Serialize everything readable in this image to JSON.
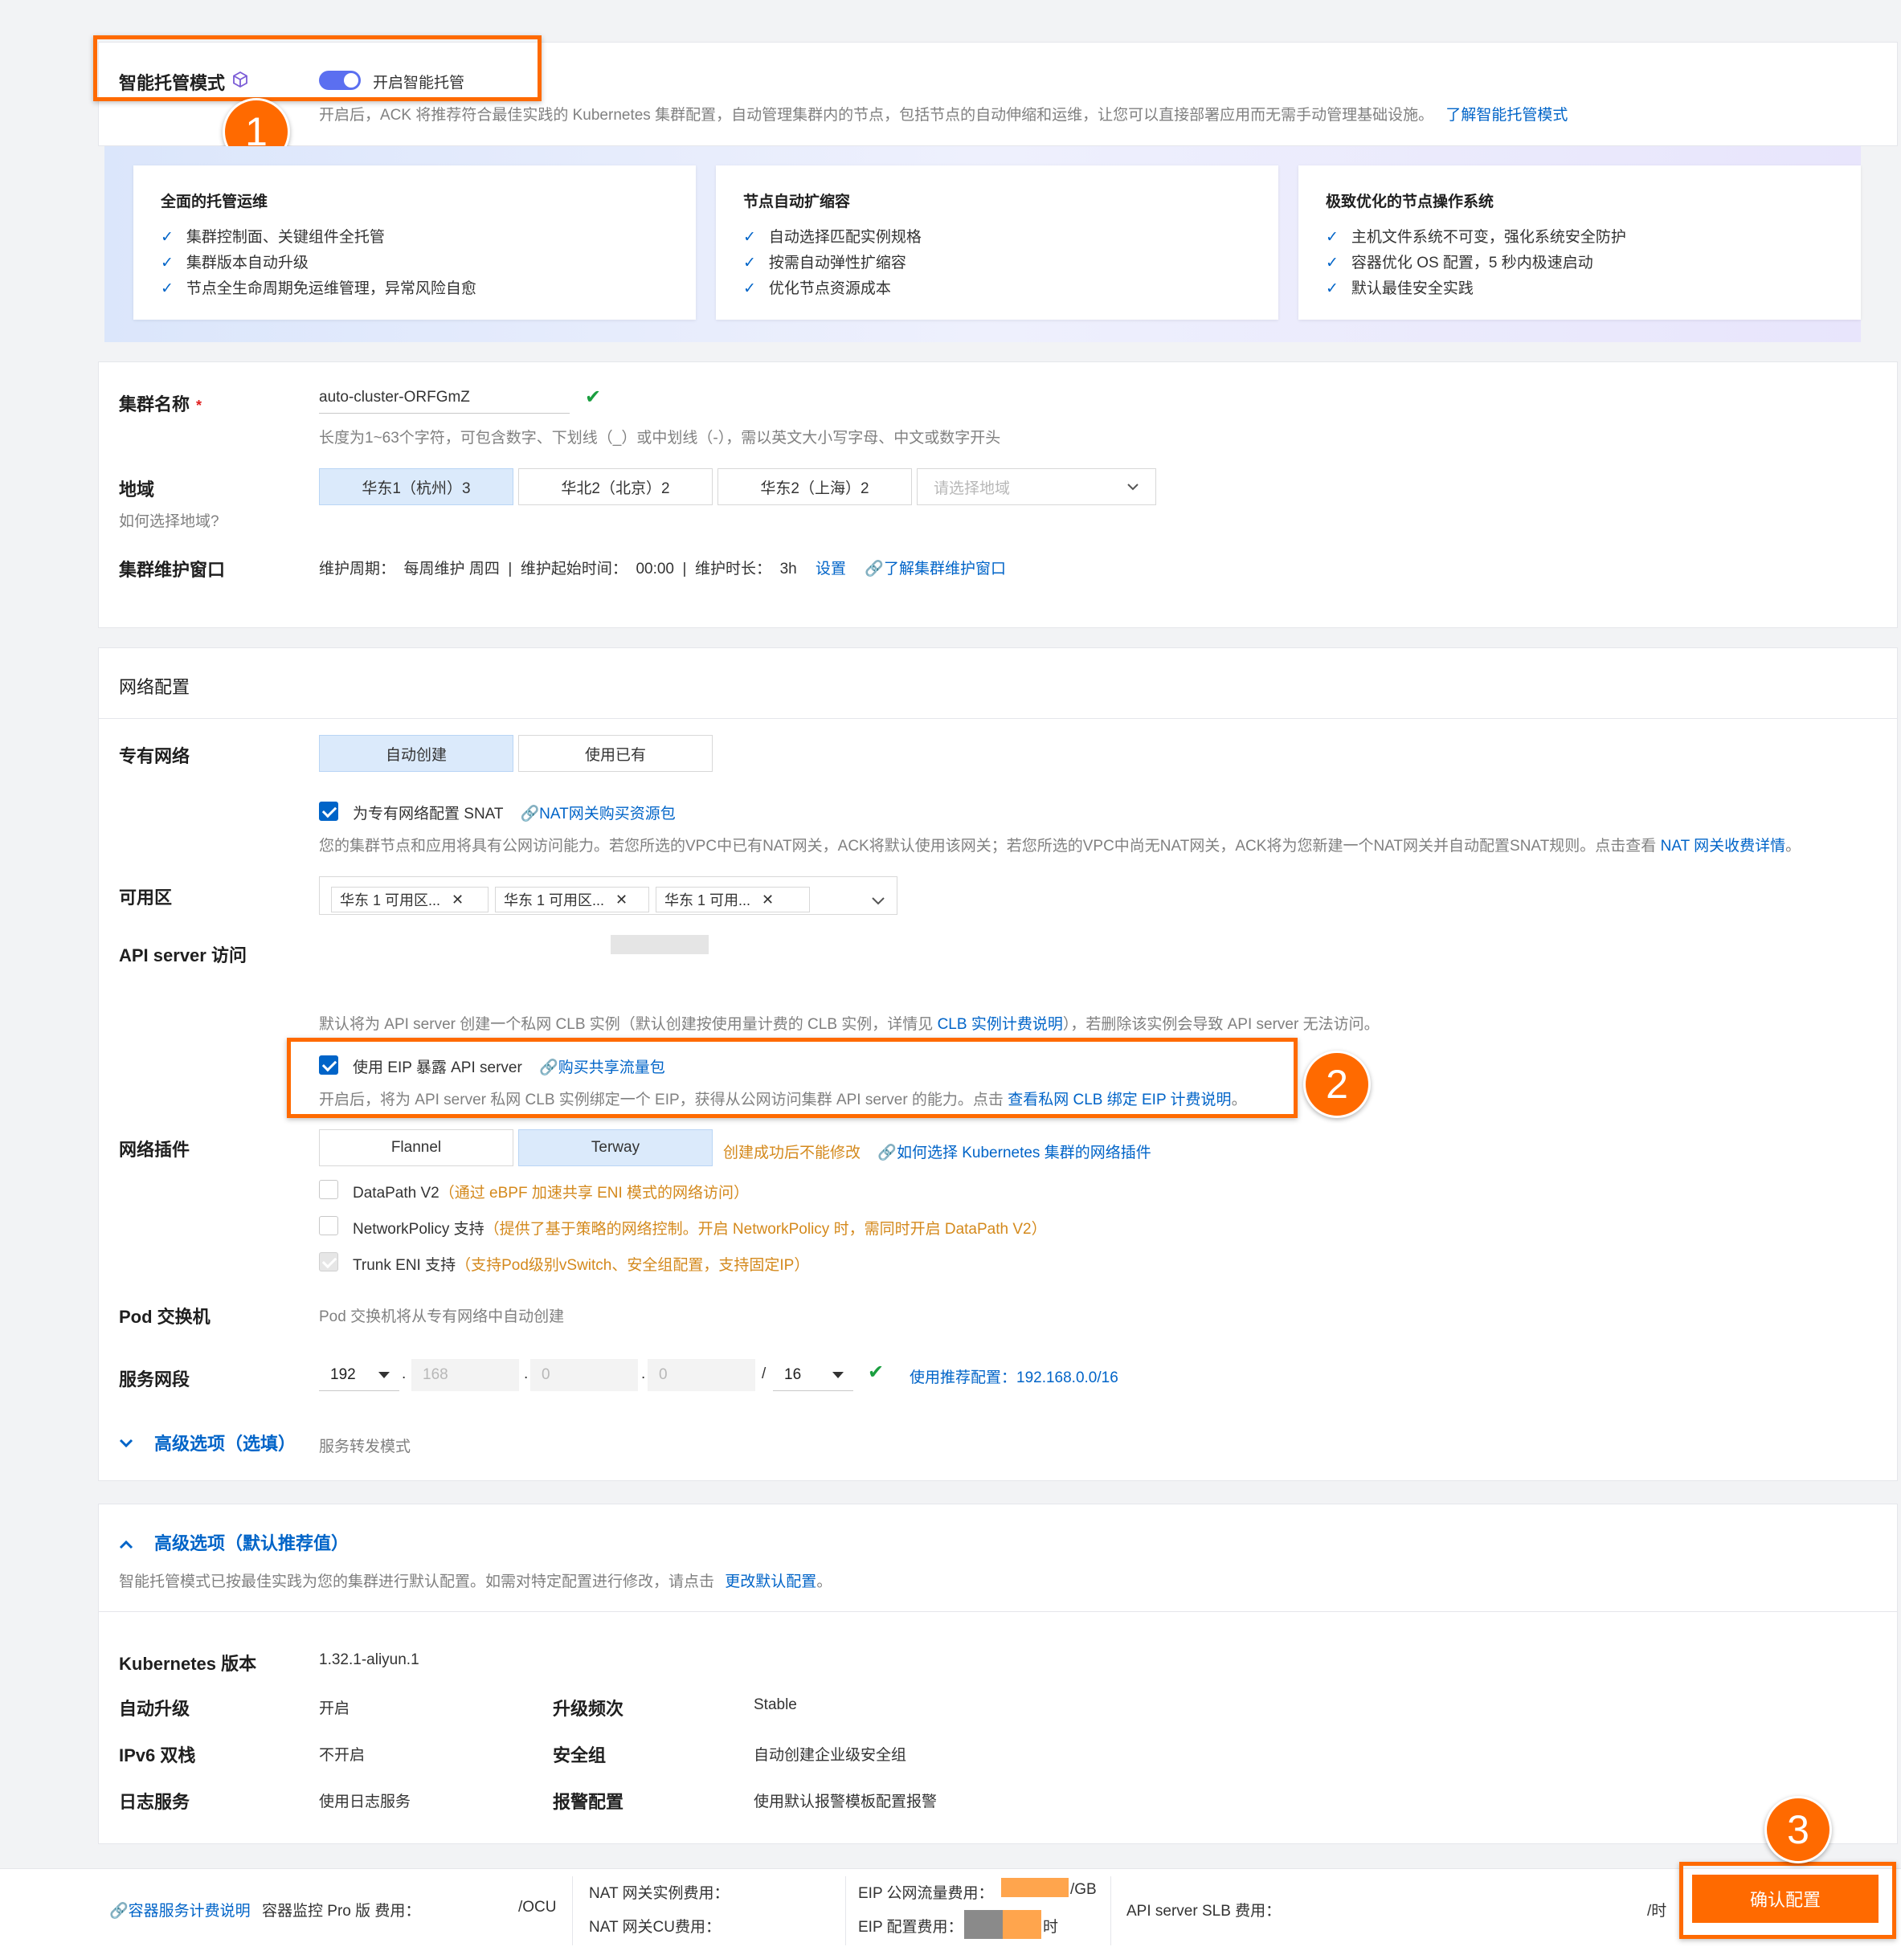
{
  "smart_mode": {
    "label": "智能托管模式",
    "toggle_label": "开启智能托管",
    "desc": "开启后，ACK 将推荐符合最佳实践的 Kubernetes 集群配置，自动管理集群内的节点，包括节点的自动伸缩和运维，让您可以直接部署应用而无需手动管理基础设施。",
    "desc_link": "了解智能托管模式",
    "features": [
      {
        "title": "全面的托管运维",
        "items": [
          "集群控制面、关键组件全托管",
          "集群版本自动升级",
          "节点全生命周期免运维管理，异常风险自愈"
        ]
      },
      {
        "title": "节点自动扩缩容",
        "items": [
          "自动选择匹配实例规格",
          "按需自动弹性扩缩容",
          "优化节点资源成本"
        ]
      },
      {
        "title": "极致优化的节点操作系统",
        "items": [
          "主机文件系统不可变，强化系统安全防护",
          "容器优化 OS 配置，5 秒内极速启动",
          "默认最佳安全实践"
        ]
      }
    ]
  },
  "cluster": {
    "name_label": "集群名称",
    "required_mark": "*",
    "name_value": "auto-cluster-ORFGmZ",
    "name_hint": "长度为1~63个字符，可包含数字、下划线（_）或中划线（-），需以英文大小写字母、中文或数字开头",
    "region_label": "地域",
    "region_help": "如何选择地域?",
    "regions": [
      "华东1（杭州）3",
      "华北2（北京）2",
      "华东2（上海）2"
    ],
    "region_placeholder": "请选择地域",
    "maint_label": "集群维护窗口",
    "maint_text": "维护周期：  每周维护 周四  |  维护起始时间：  00:00  |  维护时长：  3h",
    "maint_set": "设置",
    "maint_link": "了解集群维护窗口"
  },
  "network": {
    "title": "网络配置",
    "vpc_label": "专有网络",
    "vpc_options": [
      "自动创建",
      "使用已有"
    ],
    "snat_label": "为专有网络配置 SNAT",
    "snat_link": "NAT网关购买资源包",
    "snat_desc": "您的集群节点和应用将具有公网访问能力。若您所选的VPC中已有NAT网关，ACK将默认使用该网关；若您所选的VPC中尚无NAT网关，ACK将为您新建一个NAT网关并自动配置SNAT规则。点击查看",
    "snat_desc_link": "NAT 网关收费详情",
    "snat_desc_end": "。",
    "zone_label": "可用区",
    "zones": [
      "华东 1 可用区...",
      "华东 1 可用区...",
      "华东 1 可用..."
    ],
    "api_label": "API server 访问",
    "api_desc_pre": "默认将为 API server 创建一个私网 CLB 实例（默认创建按使用量计费的 CLB 实例，详情见",
    "api_desc_link": "CLB 实例计费说明",
    "api_desc_post": "），若删除该实例会导致 API server 无法访问。",
    "eip_label": "使用 EIP 暴露 API server",
    "eip_link": "购买共享流量包",
    "eip_desc": "开启后，将为 API server 私网 CLB 实例绑定一个 EIP，获得从公网访问集群 API server 的能力。点击",
    "eip_desc_link": "查看私网 CLB 绑定 EIP 计费说明",
    "eip_desc_end": "。",
    "plugin_label": "网络插件",
    "plugins": [
      "Flannel",
      "Terway"
    ],
    "plugin_warn": "创建成功后不能修改",
    "plugin_link": "如何选择 Kubernetes 集群的网络插件",
    "opt_datapath": "DataPath V2",
    "opt_datapath_note": "（通过 eBPF 加速共享 ENI 模式的网络访问）",
    "opt_netpolicy": "NetworkPolicy 支持",
    "opt_netpolicy_note": "（提供了基于策略的网络控制。开启 NetworkPolicy 时，需同时开启 DataPath V2）",
    "opt_trunk": "Trunk ENI 支持",
    "opt_trunk_note": "（支持Pod级别vSwitch、安全组配置，支持固定IP）",
    "pod_label": "Pod 交换机",
    "pod_text": "Pod 交换机将从专有网络中自动创建",
    "svc_label": "服务网段",
    "svc_ip": [
      "192",
      "168",
      "0",
      "0"
    ],
    "svc_dot": ".",
    "svc_slash": "/",
    "svc_mask": "16",
    "svc_recommend": "使用推荐配置：192.168.0.0/16",
    "adv_label": "高级选项（选填）",
    "adv_text": "服务转发模式"
  },
  "advanced": {
    "title": "高级选项（默认推荐值）",
    "desc": "智能托管模式已按最佳实践为您的集群进行默认配置。如需对特定配置进行修改，请点击",
    "desc_link": "更改默认配置",
    "desc_end": "。",
    "k8s_label": "Kubernetes 版本",
    "k8s_value": "1.32.1-aliyun.1",
    "auto_upgrade_label": "自动升级",
    "auto_upgrade_value": "开启",
    "upgrade_freq_label": "升级频次",
    "upgrade_freq_value": "Stable",
    "ipv6_label": "IPv6 双栈",
    "ipv6_value": "不开启",
    "sg_label": "安全组",
    "sg_value": "自动创建企业级安全组",
    "log_label": "日志服务",
    "log_value": "使用日志服务",
    "alert_label": "报警配置",
    "alert_value": "使用默认报警模板配置报警"
  },
  "footer": {
    "pricing_link": "容器服务计费说明",
    "monitor_fee": "容器监控 Pro 版 费用：",
    "ocu": "/OCU",
    "nat_instance_fee": "NAT 网关实例费用：",
    "nat_cu_fee": "NAT 网关CU费用：",
    "eip_traffic_fee": "EIP 公网流量费用：",
    "per_gb": "/GB",
    "eip_config_fee": "EIP 配置费用：",
    "per_hour": "时",
    "slb_fee": "API server SLB 费用：",
    "per_hour_slb": "/时",
    "confirm": "确认配置"
  },
  "steps": [
    "1",
    "2",
    "3"
  ],
  "colors": {
    "accent": "#0064c8",
    "highlight": "#ff6a00",
    "success": "#1a9e3f",
    "warning": "#d4891c"
  }
}
